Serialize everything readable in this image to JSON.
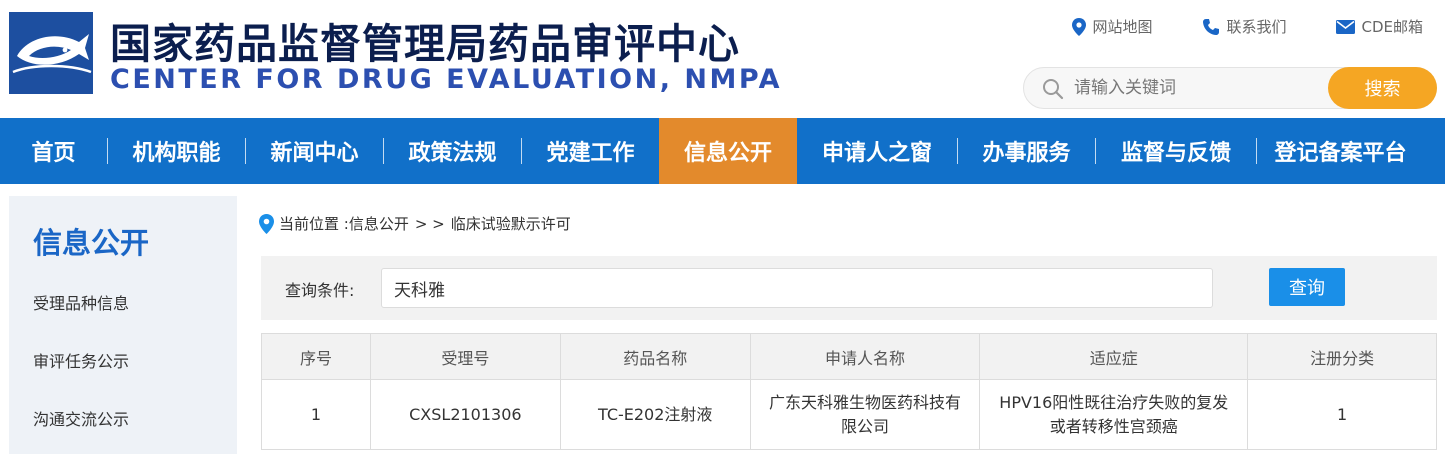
{
  "header": {
    "title_cn": "国家药品监督管理局药品审评中心",
    "title_en": "CENTER FOR DRUG EVALUATION, NMPA",
    "logo_icon": "fish-emblem-logo",
    "top_links": [
      {
        "label": "网站地图",
        "icon": "map-pin-icon"
      },
      {
        "label": "联系我们",
        "icon": "phone-icon"
      },
      {
        "label": "CDE邮箱",
        "icon": "mail-icon"
      }
    ],
    "search": {
      "placeholder": "请输入关键词",
      "button_label": "搜索"
    }
  },
  "nav": {
    "items": [
      "首页",
      "机构职能",
      "新闻中心",
      "政策法规",
      "党建工作",
      "信息公开",
      "申请人之窗",
      "办事服务",
      "监督与反馈",
      "登记备案平台"
    ],
    "active": "信息公开"
  },
  "sidebar": {
    "title": "信息公开",
    "items": [
      "受理品种信息",
      "审评任务公示",
      "沟通交流公示"
    ]
  },
  "breadcrumb": {
    "prefix": "当前位置 : ",
    "section": "信息公开",
    "separator": "> >",
    "current": "临床试验默示许可"
  },
  "query": {
    "label": "查询条件:",
    "value": "天科雅",
    "button_label": "查询"
  },
  "table": {
    "headers": [
      "序号",
      "受理号",
      "药品名称",
      "申请人名称",
      "适应症",
      "注册分类"
    ],
    "rows": [
      [
        "1",
        "CXSL2101306",
        "TC-E202注射液",
        "广东天科雅生物医药科技有限公司",
        "HPV16阳性既往治疗失败的复发或者转移性宫颈癌",
        "1"
      ]
    ]
  },
  "colors": {
    "nav_bg": "#1170c9",
    "nav_active": "#e38a2c",
    "search_button": "#f5a623",
    "query_button": "#1a8fe8",
    "title_en": "#2c4fb0",
    "sidebar_title": "#1a66c6"
  }
}
